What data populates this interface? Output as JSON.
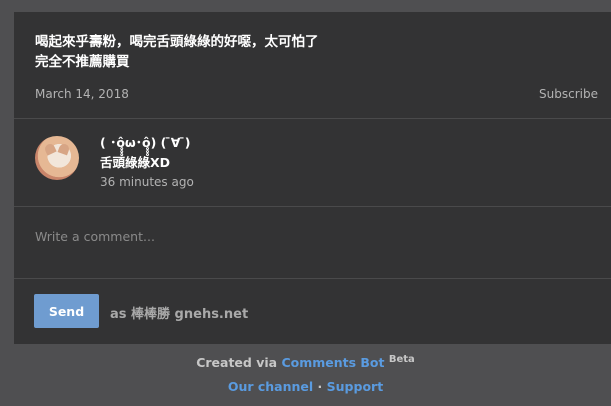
{
  "post": {
    "line1": "喝起來乎壽粉，喝完舌頭綠綠的好噁，太可怕了",
    "line2": "完全不推薦購買",
    "date": "March 14, 2018",
    "subscribe_label": "Subscribe"
  },
  "comment": {
    "name": "( ･ô̥̥̥ω･ô̥̥̥) ( ̄∀ ̄)",
    "user": "舌頭綠綠XD",
    "time": "36 minutes ago"
  },
  "composer": {
    "placeholder": "Write a comment...",
    "send_label": "Send",
    "as_user": "as 棒棒勝 gnehs.net"
  },
  "footer": {
    "created_via": "Created via ",
    "bot_name": "Comments Bot",
    "beta": "Beta",
    "our_channel": "Our channel",
    "separator": " · ",
    "support": "Support"
  },
  "colors": {
    "card_bg": "#333334",
    "page_bg": "#4f4f51",
    "accent": "#6f9cd0",
    "link": "#5a9be0"
  }
}
